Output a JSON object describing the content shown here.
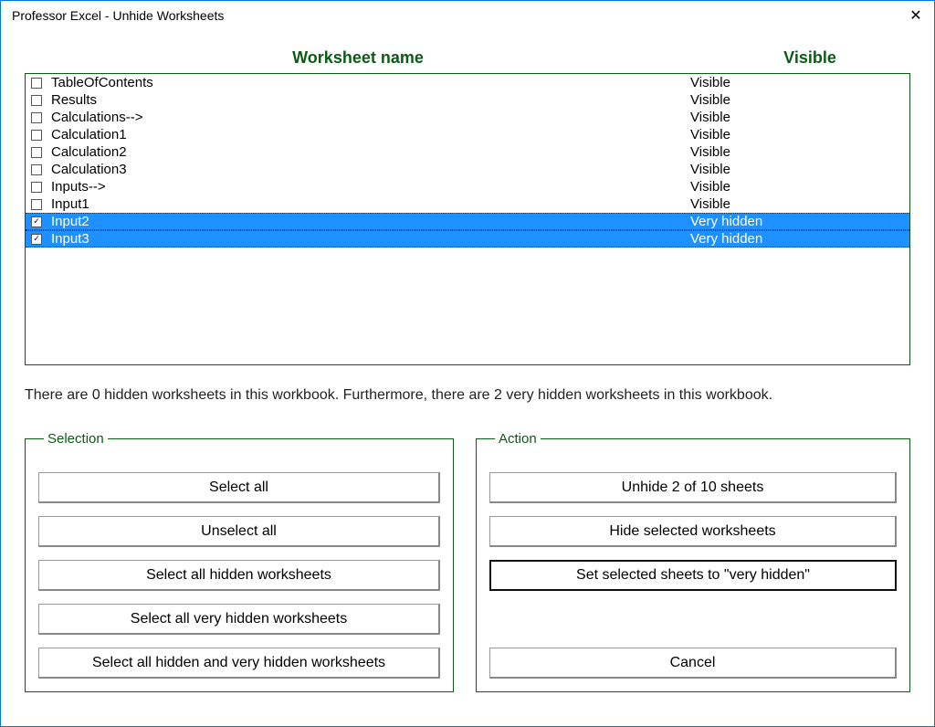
{
  "window": {
    "title": "Professor Excel - Unhide Worksheets"
  },
  "columns": {
    "name": "Worksheet name",
    "visible": "Visible"
  },
  "rows": [
    {
      "name": "TableOfContents",
      "visible": "Visible",
      "checked": false,
      "selected": false
    },
    {
      "name": "Results",
      "visible": "Visible",
      "checked": false,
      "selected": false
    },
    {
      "name": "Calculations-->",
      "visible": "Visible",
      "checked": false,
      "selected": false
    },
    {
      "name": "Calculation1",
      "visible": "Visible",
      "checked": false,
      "selected": false
    },
    {
      "name": "Calculation2",
      "visible": "Visible",
      "checked": false,
      "selected": false
    },
    {
      "name": "Calculation3",
      "visible": "Visible",
      "checked": false,
      "selected": false
    },
    {
      "name": "Inputs-->",
      "visible": "Visible",
      "checked": false,
      "selected": false
    },
    {
      "name": "Input1",
      "visible": "Visible",
      "checked": false,
      "selected": false
    },
    {
      "name": "Input2",
      "visible": "Very hidden",
      "checked": true,
      "selected": true
    },
    {
      "name": "Input3",
      "visible": "Very hidden",
      "checked": true,
      "selected": true
    }
  ],
  "status": "There are 0 hidden worksheets in this workbook. Furthermore, there are 2 very hidden worksheets in this workbook.",
  "selection": {
    "legend": "Selection",
    "select_all": "Select all",
    "unselect_all": "Unselect all",
    "select_hidden": "Select all hidden worksheets",
    "select_very_hidden": "Select all very hidden worksheets",
    "select_all_hidden": "Select all hidden and very hidden worksheets"
  },
  "action": {
    "legend": "Action",
    "unhide": "Unhide 2 of 10 sheets",
    "hide": "Hide selected worksheets",
    "very_hidden": "Set selected sheets to \"very hidden\"",
    "cancel": "Cancel"
  }
}
